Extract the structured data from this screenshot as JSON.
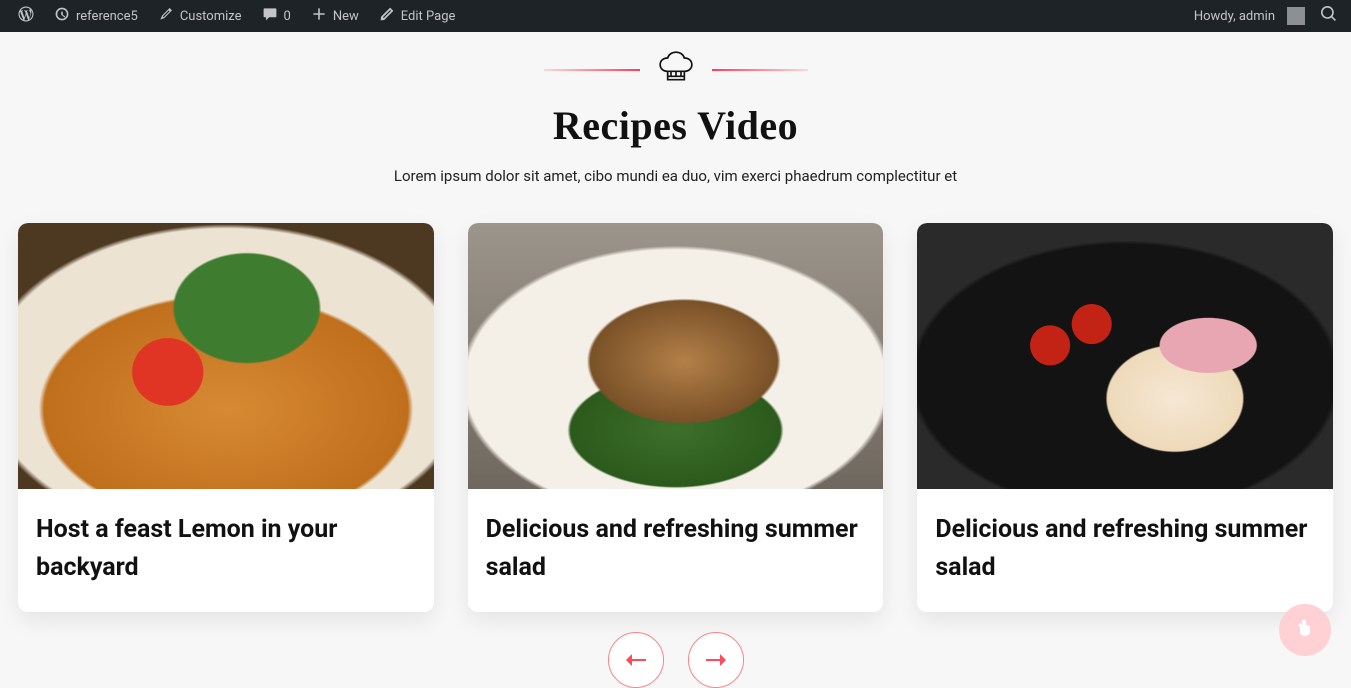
{
  "adminbar": {
    "site": "reference5",
    "customize": "Customize",
    "comments": "0",
    "new": "New",
    "edit": "Edit Page",
    "howdy": "Howdy, admin"
  },
  "section": {
    "title": "Recipes Video",
    "subtitle": "Lorem ipsum dolor sit amet, cibo mundi ea duo, vim exerci phaedrum complectitur et"
  },
  "cards": [
    {
      "title": "Host a feast Lemon in your backyard"
    },
    {
      "title": "Delicious and refreshing summer salad"
    },
    {
      "title": "Delicious and refreshing summer salad"
    }
  ]
}
